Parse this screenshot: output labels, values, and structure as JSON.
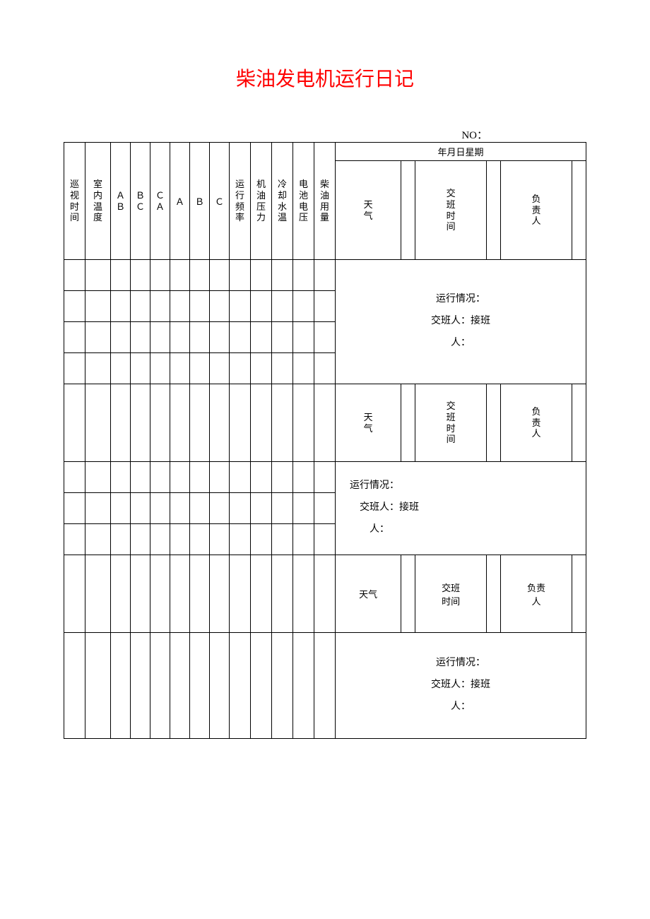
{
  "title": "柴油发电机运行日记",
  "no_label": "NO：",
  "date_header": "年月日星期",
  "headers": {
    "inspect_time": "巡视时间",
    "room_temp": "室内温度",
    "ab": "ＡＢ",
    "bc": "ＢＣ",
    "ca": "ＣＡ",
    "a": "Ａ",
    "b": "Ｂ",
    "c": "Ｃ",
    "run_freq": "运行频率",
    "oil_pressure": "机油压力",
    "cool_temp": "冷却水温",
    "battery_volt": "电池电压",
    "diesel_usage": "柴油用量",
    "weather": "天气",
    "shift_time": "交班时间",
    "supervisor": "负责人"
  },
  "side": {
    "run_status": "运行情况：",
    "handover": "交班人：",
    "takeover_prefix": "接班",
    "person_suffix": "人："
  }
}
